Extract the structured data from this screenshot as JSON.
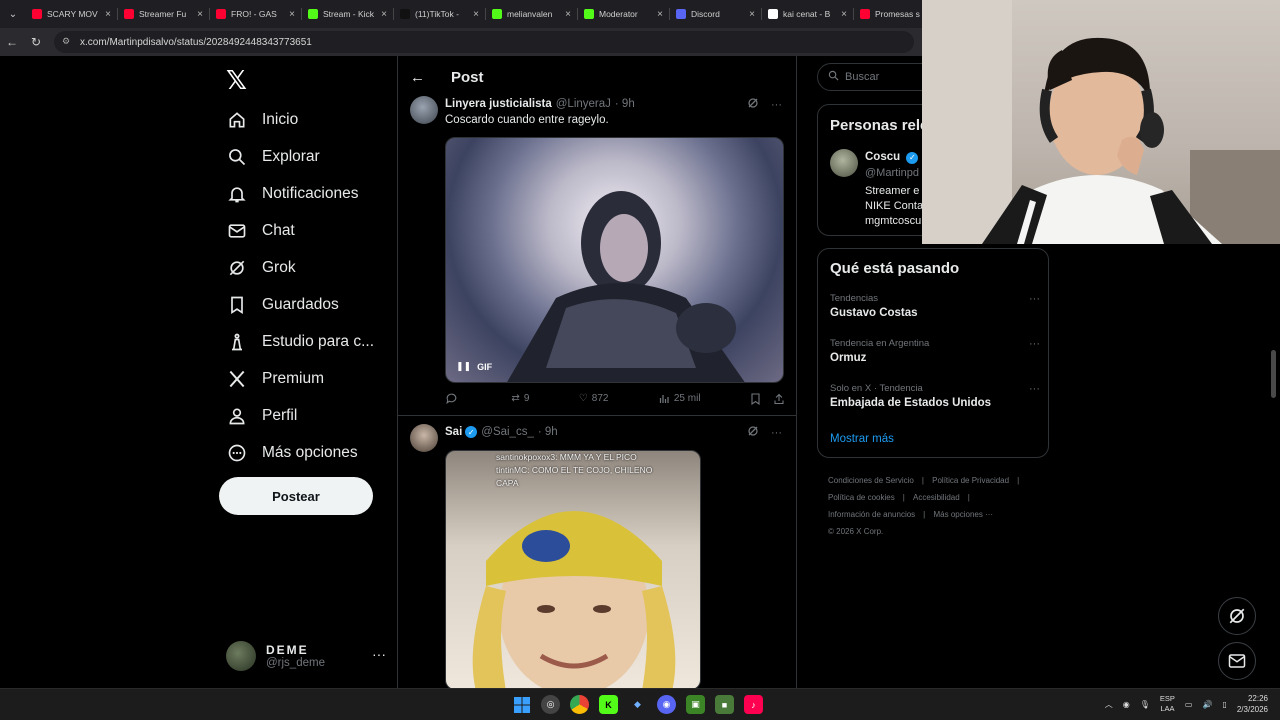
{
  "browser": {
    "tabs": [
      {
        "title": "SCARY MOV",
        "icon": "youtube-icon",
        "color": "#ff0033"
      },
      {
        "title": "Streamer Fu",
        "icon": "youtube-icon",
        "color": "#ff0033"
      },
      {
        "title": "FRO! - GAS",
        "icon": "youtube-icon",
        "color": "#ff0033"
      },
      {
        "title": "Stream - Kick",
        "icon": "kick-icon",
        "color": "#53fc18"
      },
      {
        "title": "(11)TikTok -",
        "icon": "tiktok-icon",
        "color": "#111111"
      },
      {
        "title": "melianvalen",
        "icon": "kick-icon",
        "color": "#53fc18"
      },
      {
        "title": "Moderator",
        "icon": "kick-icon",
        "color": "#53fc18"
      },
      {
        "title": "Discord",
        "icon": "discord-icon",
        "color": "#5865f2"
      },
      {
        "title": "kai cenat - B",
        "icon": "google-icon",
        "color": "#ffffff"
      },
      {
        "title": "Promesas s",
        "icon": "youtube-icon",
        "color": "#ff0033"
      }
    ],
    "url": "x.com/Martinpdisalvo/status/2028492448343773651"
  },
  "nav": {
    "items": [
      {
        "label": "Inicio",
        "icon": "home-icon"
      },
      {
        "label": "Explorar",
        "icon": "search-icon"
      },
      {
        "label": "Notificaciones",
        "icon": "bell-icon"
      },
      {
        "label": "Chat",
        "icon": "mail-icon"
      },
      {
        "label": "Grok",
        "icon": "grok-icon"
      },
      {
        "label": "Guardados",
        "icon": "bookmark-icon"
      },
      {
        "label": "Estudio para c...",
        "icon": "flask-icon"
      },
      {
        "label": "Premium",
        "icon": "x-logo-icon"
      },
      {
        "label": "Perfil",
        "icon": "user-icon"
      },
      {
        "label": "Más opciones",
        "icon": "more-circle-icon"
      }
    ],
    "post_label": "Postear",
    "profile": {
      "name": "DEME",
      "handle": "@rjs_deme",
      "more": "···"
    }
  },
  "center": {
    "title": "Post",
    "tweets": [
      {
        "name": "Linyera justicialista",
        "handle": "@LinyeraJ",
        "time": "· 9h",
        "text": "Coscardo cuando entre rageylo.",
        "media_badge": "GIF",
        "replies": "",
        "reposts": "9",
        "likes": "872",
        "views": "25 mil"
      },
      {
        "name": "Sai",
        "handle": "@Sai_cs_",
        "time": "· 9h",
        "overlay_chat": [
          "santinokpoxox3: MMM YA Y EL PICO",
          "tintinMC: COMO EL TE COJO, CHILENO",
          "CAPA"
        ]
      }
    ]
  },
  "right": {
    "search_placeholder": "Buscar",
    "who_to_follow_title": "Personas rele",
    "suggested": {
      "name": "Coscu",
      "handle": "@Martinpd",
      "bio_lines": [
        "Streamer e",
        "NIKE Conta",
        "mgmtcoscu"
      ]
    },
    "trends_title": "Qué está pasando",
    "trends": [
      {
        "context": "Tendencias",
        "name": "Gustavo Costas"
      },
      {
        "context": "Tendencia en Argentina",
        "name": "Ormuz"
      },
      {
        "context": "Solo en X · Tendencia",
        "name": "Embajada de Estados Unidos"
      }
    ],
    "show_more": "Mostrar más",
    "footer_links": [
      "Condiciones de Servicio",
      "Política de Privacidad",
      "Política de cookies",
      "Accesibilidad",
      "Información de anuncios",
      "Más opciones ···"
    ],
    "copyright": "© 2026 X Corp."
  },
  "taskbar": {
    "lang_top": "ESP",
    "lang_bottom": "LAA",
    "time": "22:26",
    "date": "2/3/2026"
  },
  "colors": {
    "accent": "#1d9bf0",
    "background": "#000000",
    "border": "#2f3336",
    "muted": "#71767b"
  }
}
